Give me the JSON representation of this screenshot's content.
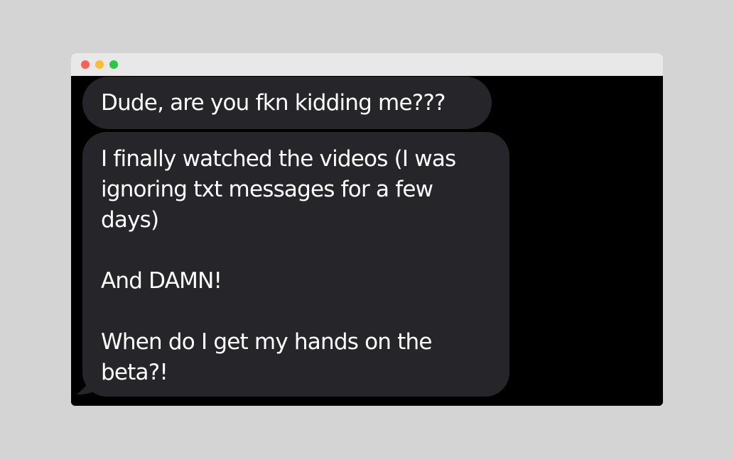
{
  "window": {
    "traffic_lights": {
      "close": "#fe5f57",
      "minimize": "#febc2e",
      "zoom": "#28c840"
    }
  },
  "messages": [
    {
      "lines": [
        "Dude, are you fkn kidding me???"
      ]
    },
    {
      "paragraphs": [
        [
          "I finally watched the videos (I was",
          "ignoring txt messages for a few",
          "days)"
        ],
        [
          "And DAMN!"
        ],
        [
          "When do I get my hands on the",
          "beta?!"
        ]
      ]
    }
  ],
  "colors": {
    "bubble": "#26252a",
    "background": "#000000",
    "text": "#ffffff"
  }
}
